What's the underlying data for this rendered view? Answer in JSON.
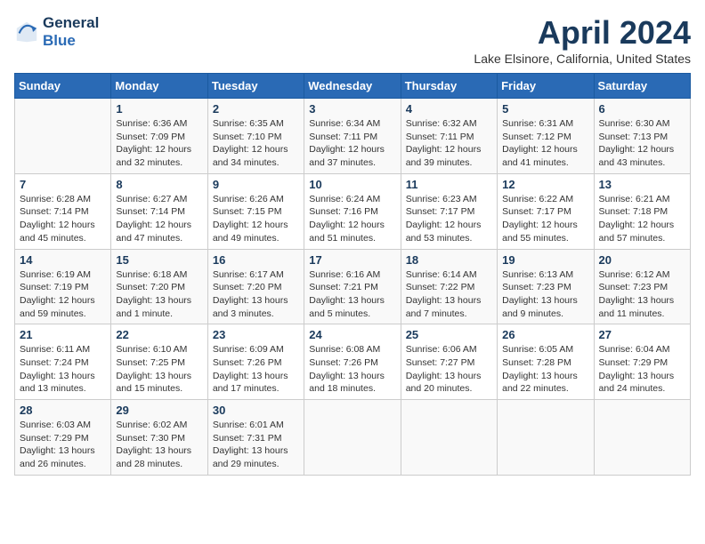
{
  "header": {
    "logo_line1": "General",
    "logo_line2": "Blue",
    "month": "April 2024",
    "location": "Lake Elsinore, California, United States"
  },
  "days_of_week": [
    "Sunday",
    "Monday",
    "Tuesday",
    "Wednesday",
    "Thursday",
    "Friday",
    "Saturday"
  ],
  "weeks": [
    [
      null,
      {
        "day": 1,
        "sunrise": "Sunrise: 6:36 AM",
        "sunset": "Sunset: 7:09 PM",
        "daylight": "Daylight: 12 hours and 32 minutes."
      },
      {
        "day": 2,
        "sunrise": "Sunrise: 6:35 AM",
        "sunset": "Sunset: 7:10 PM",
        "daylight": "Daylight: 12 hours and 34 minutes."
      },
      {
        "day": 3,
        "sunrise": "Sunrise: 6:34 AM",
        "sunset": "Sunset: 7:11 PM",
        "daylight": "Daylight: 12 hours and 37 minutes."
      },
      {
        "day": 4,
        "sunrise": "Sunrise: 6:32 AM",
        "sunset": "Sunset: 7:11 PM",
        "daylight": "Daylight: 12 hours and 39 minutes."
      },
      {
        "day": 5,
        "sunrise": "Sunrise: 6:31 AM",
        "sunset": "Sunset: 7:12 PM",
        "daylight": "Daylight: 12 hours and 41 minutes."
      },
      {
        "day": 6,
        "sunrise": "Sunrise: 6:30 AM",
        "sunset": "Sunset: 7:13 PM",
        "daylight": "Daylight: 12 hours and 43 minutes."
      }
    ],
    [
      {
        "day": 7,
        "sunrise": "Sunrise: 6:28 AM",
        "sunset": "Sunset: 7:14 PM",
        "daylight": "Daylight: 12 hours and 45 minutes."
      },
      {
        "day": 8,
        "sunrise": "Sunrise: 6:27 AM",
        "sunset": "Sunset: 7:14 PM",
        "daylight": "Daylight: 12 hours and 47 minutes."
      },
      {
        "day": 9,
        "sunrise": "Sunrise: 6:26 AM",
        "sunset": "Sunset: 7:15 PM",
        "daylight": "Daylight: 12 hours and 49 minutes."
      },
      {
        "day": 10,
        "sunrise": "Sunrise: 6:24 AM",
        "sunset": "Sunset: 7:16 PM",
        "daylight": "Daylight: 12 hours and 51 minutes."
      },
      {
        "day": 11,
        "sunrise": "Sunrise: 6:23 AM",
        "sunset": "Sunset: 7:17 PM",
        "daylight": "Daylight: 12 hours and 53 minutes."
      },
      {
        "day": 12,
        "sunrise": "Sunrise: 6:22 AM",
        "sunset": "Sunset: 7:17 PM",
        "daylight": "Daylight: 12 hours and 55 minutes."
      },
      {
        "day": 13,
        "sunrise": "Sunrise: 6:21 AM",
        "sunset": "Sunset: 7:18 PM",
        "daylight": "Daylight: 12 hours and 57 minutes."
      }
    ],
    [
      {
        "day": 14,
        "sunrise": "Sunrise: 6:19 AM",
        "sunset": "Sunset: 7:19 PM",
        "daylight": "Daylight: 12 hours and 59 minutes."
      },
      {
        "day": 15,
        "sunrise": "Sunrise: 6:18 AM",
        "sunset": "Sunset: 7:20 PM",
        "daylight": "Daylight: 13 hours and 1 minute."
      },
      {
        "day": 16,
        "sunrise": "Sunrise: 6:17 AM",
        "sunset": "Sunset: 7:20 PM",
        "daylight": "Daylight: 13 hours and 3 minutes."
      },
      {
        "day": 17,
        "sunrise": "Sunrise: 6:16 AM",
        "sunset": "Sunset: 7:21 PM",
        "daylight": "Daylight: 13 hours and 5 minutes."
      },
      {
        "day": 18,
        "sunrise": "Sunrise: 6:14 AM",
        "sunset": "Sunset: 7:22 PM",
        "daylight": "Daylight: 13 hours and 7 minutes."
      },
      {
        "day": 19,
        "sunrise": "Sunrise: 6:13 AM",
        "sunset": "Sunset: 7:23 PM",
        "daylight": "Daylight: 13 hours and 9 minutes."
      },
      {
        "day": 20,
        "sunrise": "Sunrise: 6:12 AM",
        "sunset": "Sunset: 7:23 PM",
        "daylight": "Daylight: 13 hours and 11 minutes."
      }
    ],
    [
      {
        "day": 21,
        "sunrise": "Sunrise: 6:11 AM",
        "sunset": "Sunset: 7:24 PM",
        "daylight": "Daylight: 13 hours and 13 minutes."
      },
      {
        "day": 22,
        "sunrise": "Sunrise: 6:10 AM",
        "sunset": "Sunset: 7:25 PM",
        "daylight": "Daylight: 13 hours and 15 minutes."
      },
      {
        "day": 23,
        "sunrise": "Sunrise: 6:09 AM",
        "sunset": "Sunset: 7:26 PM",
        "daylight": "Daylight: 13 hours and 17 minutes."
      },
      {
        "day": 24,
        "sunrise": "Sunrise: 6:08 AM",
        "sunset": "Sunset: 7:26 PM",
        "daylight": "Daylight: 13 hours and 18 minutes."
      },
      {
        "day": 25,
        "sunrise": "Sunrise: 6:06 AM",
        "sunset": "Sunset: 7:27 PM",
        "daylight": "Daylight: 13 hours and 20 minutes."
      },
      {
        "day": 26,
        "sunrise": "Sunrise: 6:05 AM",
        "sunset": "Sunset: 7:28 PM",
        "daylight": "Daylight: 13 hours and 22 minutes."
      },
      {
        "day": 27,
        "sunrise": "Sunrise: 6:04 AM",
        "sunset": "Sunset: 7:29 PM",
        "daylight": "Daylight: 13 hours and 24 minutes."
      }
    ],
    [
      {
        "day": 28,
        "sunrise": "Sunrise: 6:03 AM",
        "sunset": "Sunset: 7:29 PM",
        "daylight": "Daylight: 13 hours and 26 minutes."
      },
      {
        "day": 29,
        "sunrise": "Sunrise: 6:02 AM",
        "sunset": "Sunset: 7:30 PM",
        "daylight": "Daylight: 13 hours and 28 minutes."
      },
      {
        "day": 30,
        "sunrise": "Sunrise: 6:01 AM",
        "sunset": "Sunset: 7:31 PM",
        "daylight": "Daylight: 13 hours and 29 minutes."
      },
      null,
      null,
      null,
      null
    ]
  ]
}
